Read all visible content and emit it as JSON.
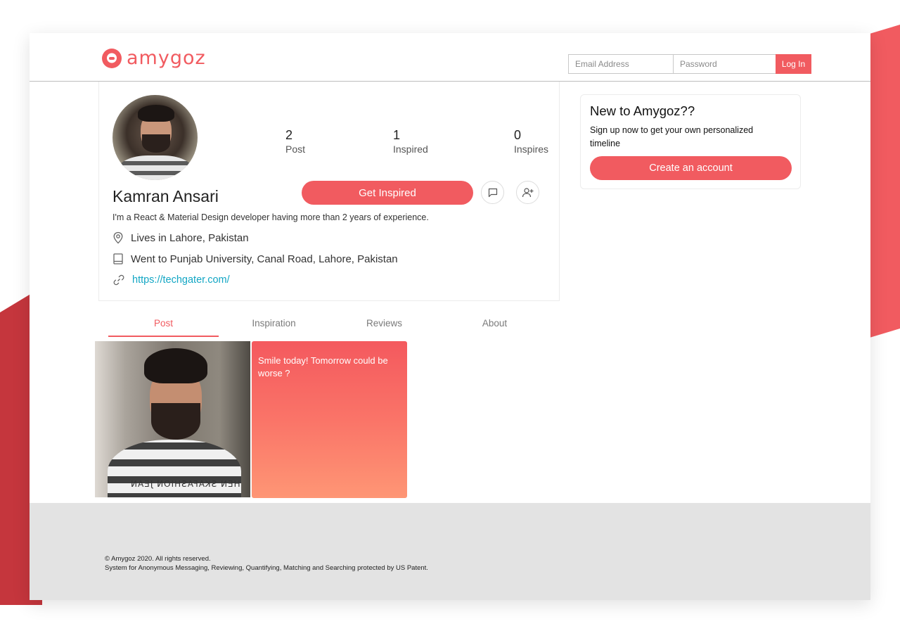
{
  "brand": {
    "name": "amygoz",
    "colors": {
      "primary": "#f15b60",
      "link": "#12a6c4",
      "footer_bg": "#e3e3e3"
    }
  },
  "header": {
    "email_placeholder": "Email Address",
    "password_placeholder": "Password",
    "login_label": "Log In"
  },
  "profile": {
    "name": "Kamran Ansari",
    "stats": [
      {
        "value": "2",
        "label": "Post"
      },
      {
        "value": "1",
        "label": "Inspired"
      },
      {
        "value": "0",
        "label": "Inspires"
      }
    ],
    "get_inspired_label": "Get Inspired",
    "bio": "I'm a React & Material Design developer having more than 2 years of experience.",
    "location": "Lives in Lahore, Pakistan",
    "education": "Went to Punjab University, Canal Road, Lahore, Pakistan",
    "website": "https://techgater.com/",
    "icons": [
      "location-pin-icon",
      "book-icon",
      "link-icon",
      "message-icon",
      "add-user-icon"
    ]
  },
  "tabs": [
    {
      "label": "Post",
      "active": true
    },
    {
      "label": "Inspiration",
      "active": false
    },
    {
      "label": "Reviews",
      "active": false
    },
    {
      "label": "About",
      "active": false
    }
  ],
  "posts": [
    {
      "type": "photo",
      "shirt_text": "HEN SKAFASHION JEAN"
    },
    {
      "type": "text",
      "text": "Smile today! Tomorrow could be worse ?"
    }
  ],
  "signup": {
    "title": "New to Amygoz??",
    "text": "Sign up now to get your own personalized timeline",
    "button_label": "Create an account"
  },
  "footer": {
    "copyright": "© Amygoz 2020. All rights reserved.",
    "patent": "System for Anonymous Messaging, Reviewing, Quantifying, Matching and Searching protected by US Patent."
  }
}
